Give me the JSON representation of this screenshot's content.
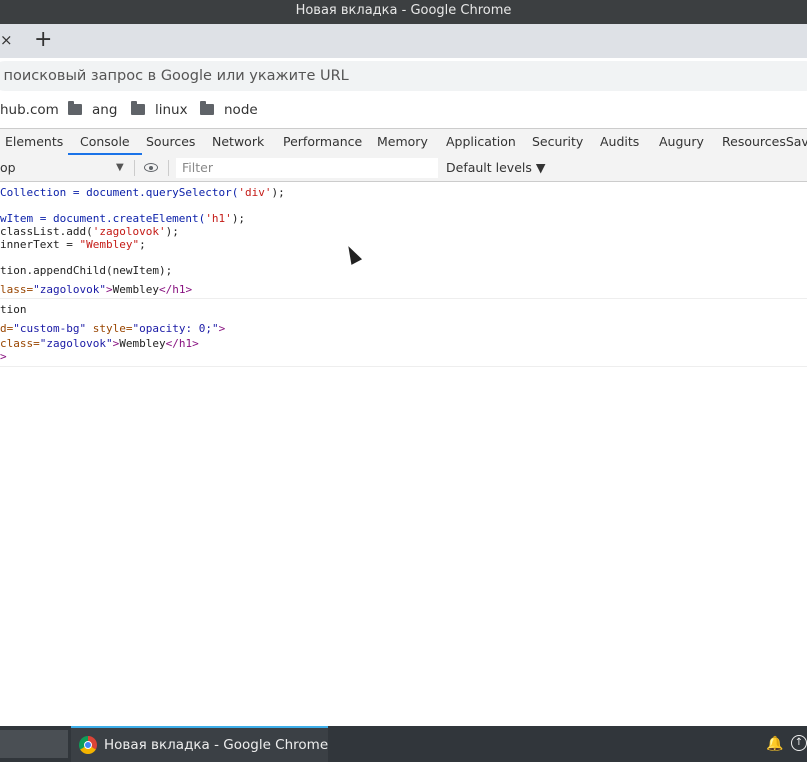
{
  "window": {
    "title": "Новая вкладка - Google Chrome"
  },
  "tabstrip": {
    "close_glyph": "×",
    "newtab_glyph": "+"
  },
  "omnibox": {
    "placeholder": "е поисковый запрос в Google или укажите URL"
  },
  "bookmarks": [
    {
      "label": "hub.com",
      "icon": ""
    },
    {
      "label": "ang",
      "icon": "folder-icon"
    },
    {
      "label": "linux",
      "icon": "folder-icon"
    },
    {
      "label": "node",
      "icon": "folder-icon"
    }
  ],
  "devtools": {
    "tabs": [
      "Elements",
      "Console",
      "Sources",
      "Network",
      "Performance",
      "Memory",
      "Application",
      "Security",
      "Audits",
      "Augury",
      "ResourcesSaver"
    ],
    "active_tab": "Console",
    "context": "op",
    "filter_placeholder": "Filter",
    "levels": "Default levels ▼"
  },
  "console": {
    "l1a": "Collection = document.querySelector(",
    "l1b": "'div'",
    "l1c": ");",
    "l2a": "wItem = document.createElement(",
    "l2b": "'h1'",
    "l2c": ");",
    "l3a": "classList.add(",
    "l3b": "'zagolovok'",
    "l3c": ");",
    "l4a": "innerText = ",
    "l4b": "\"Wembley\"",
    "l4c": ";",
    "l5": "tion.appendChild(newItem);",
    "r1a": "lass=",
    "r1b": "\"zagolovok\"",
    "r1c": ">",
    "r1d": "Wembley",
    "r1e": "</h1>",
    "l6": "tion",
    "r2a": "d=",
    "r2b": "\"custom-bg\"",
    "r2c": " style=",
    "r2d": "\"opacity: 0;\"",
    "r2e": ">",
    "r3a": "class=",
    "r3b": "\"zagolovok\"",
    "r3c": ">",
    "r3d": "Wembley",
    "r3e": "</h1>",
    "r4": ">"
  },
  "taskbar": {
    "task_label": "Новая вкладка - Google Chrome",
    "bell": "🔔",
    "tray": "↑"
  },
  "colors": {
    "accent": "#1a73e8",
    "taskbar_accent": "#3daee9",
    "string": "#c41a16",
    "tag": "#881280"
  }
}
